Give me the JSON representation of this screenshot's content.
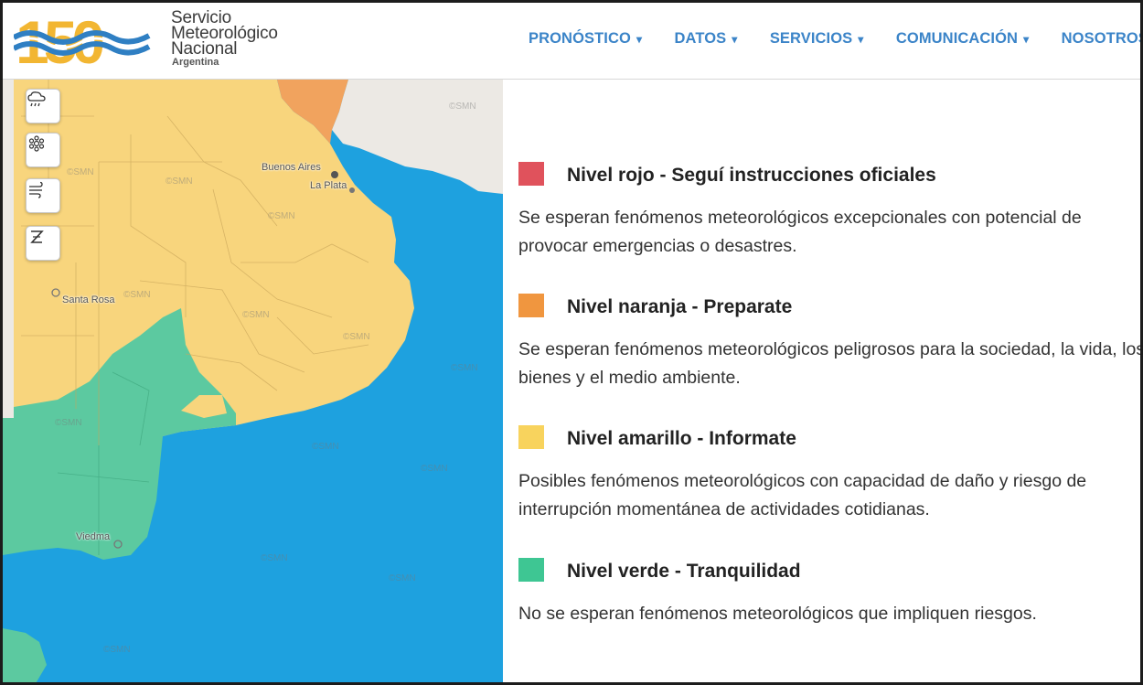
{
  "header": {
    "logo_number": "150",
    "logo_lines": [
      "Servicio",
      "Meteorológico",
      "Nacional"
    ],
    "logo_country": "Argentina",
    "nav": [
      {
        "label": "PRONÓSTICO"
      },
      {
        "label": "DATOS"
      },
      {
        "label": "SERVICIOS"
      },
      {
        "label": "COMUNICACIÓN"
      },
      {
        "label": "NOSOTROS"
      }
    ]
  },
  "map": {
    "tools": [
      {
        "icon": "rain-cloud-icon"
      },
      {
        "icon": "snowflake-icon"
      },
      {
        "icon": "wind-icon"
      },
      {
        "icon": "zonda-icon"
      }
    ],
    "places": {
      "buenos_aires": "Buenos Aires",
      "la_plata": "La Plata",
      "santa_rosa": "Santa Rosa",
      "viedma": "Viedma"
    },
    "watermark": "©SMN",
    "colors": {
      "sea": "#1ea1df",
      "yellow": "#f8d57d",
      "orange": "#f1a35e",
      "green": "#5cc9a0",
      "land_gray": "#ece9e4"
    }
  },
  "levels": [
    {
      "color": "#e0525c",
      "title": "Nivel rojo - Seguí instrucciones oficiales",
      "desc": "Se esperan fenómenos meteorológicos excepcionales con potencial de provocar emergencias o desastres."
    },
    {
      "color": "#f0963f",
      "title": "Nivel naranja - Preparate",
      "desc": "Se esperan fenómenos meteorológicos peligrosos para la sociedad, la vida, los bienes y el medio ambiente."
    },
    {
      "color": "#f8d35d",
      "title": "Nivel amarillo - Informate",
      "desc": "Posibles fenómenos meteorológicos con capacidad de daño y riesgo de interrupción momentánea de actividades cotidianas."
    },
    {
      "color": "#3ec693",
      "title": "Nivel verde - Tranquilidad",
      "desc": "No se esperan fenómenos meteorológicos que impliquen riesgos."
    }
  ]
}
